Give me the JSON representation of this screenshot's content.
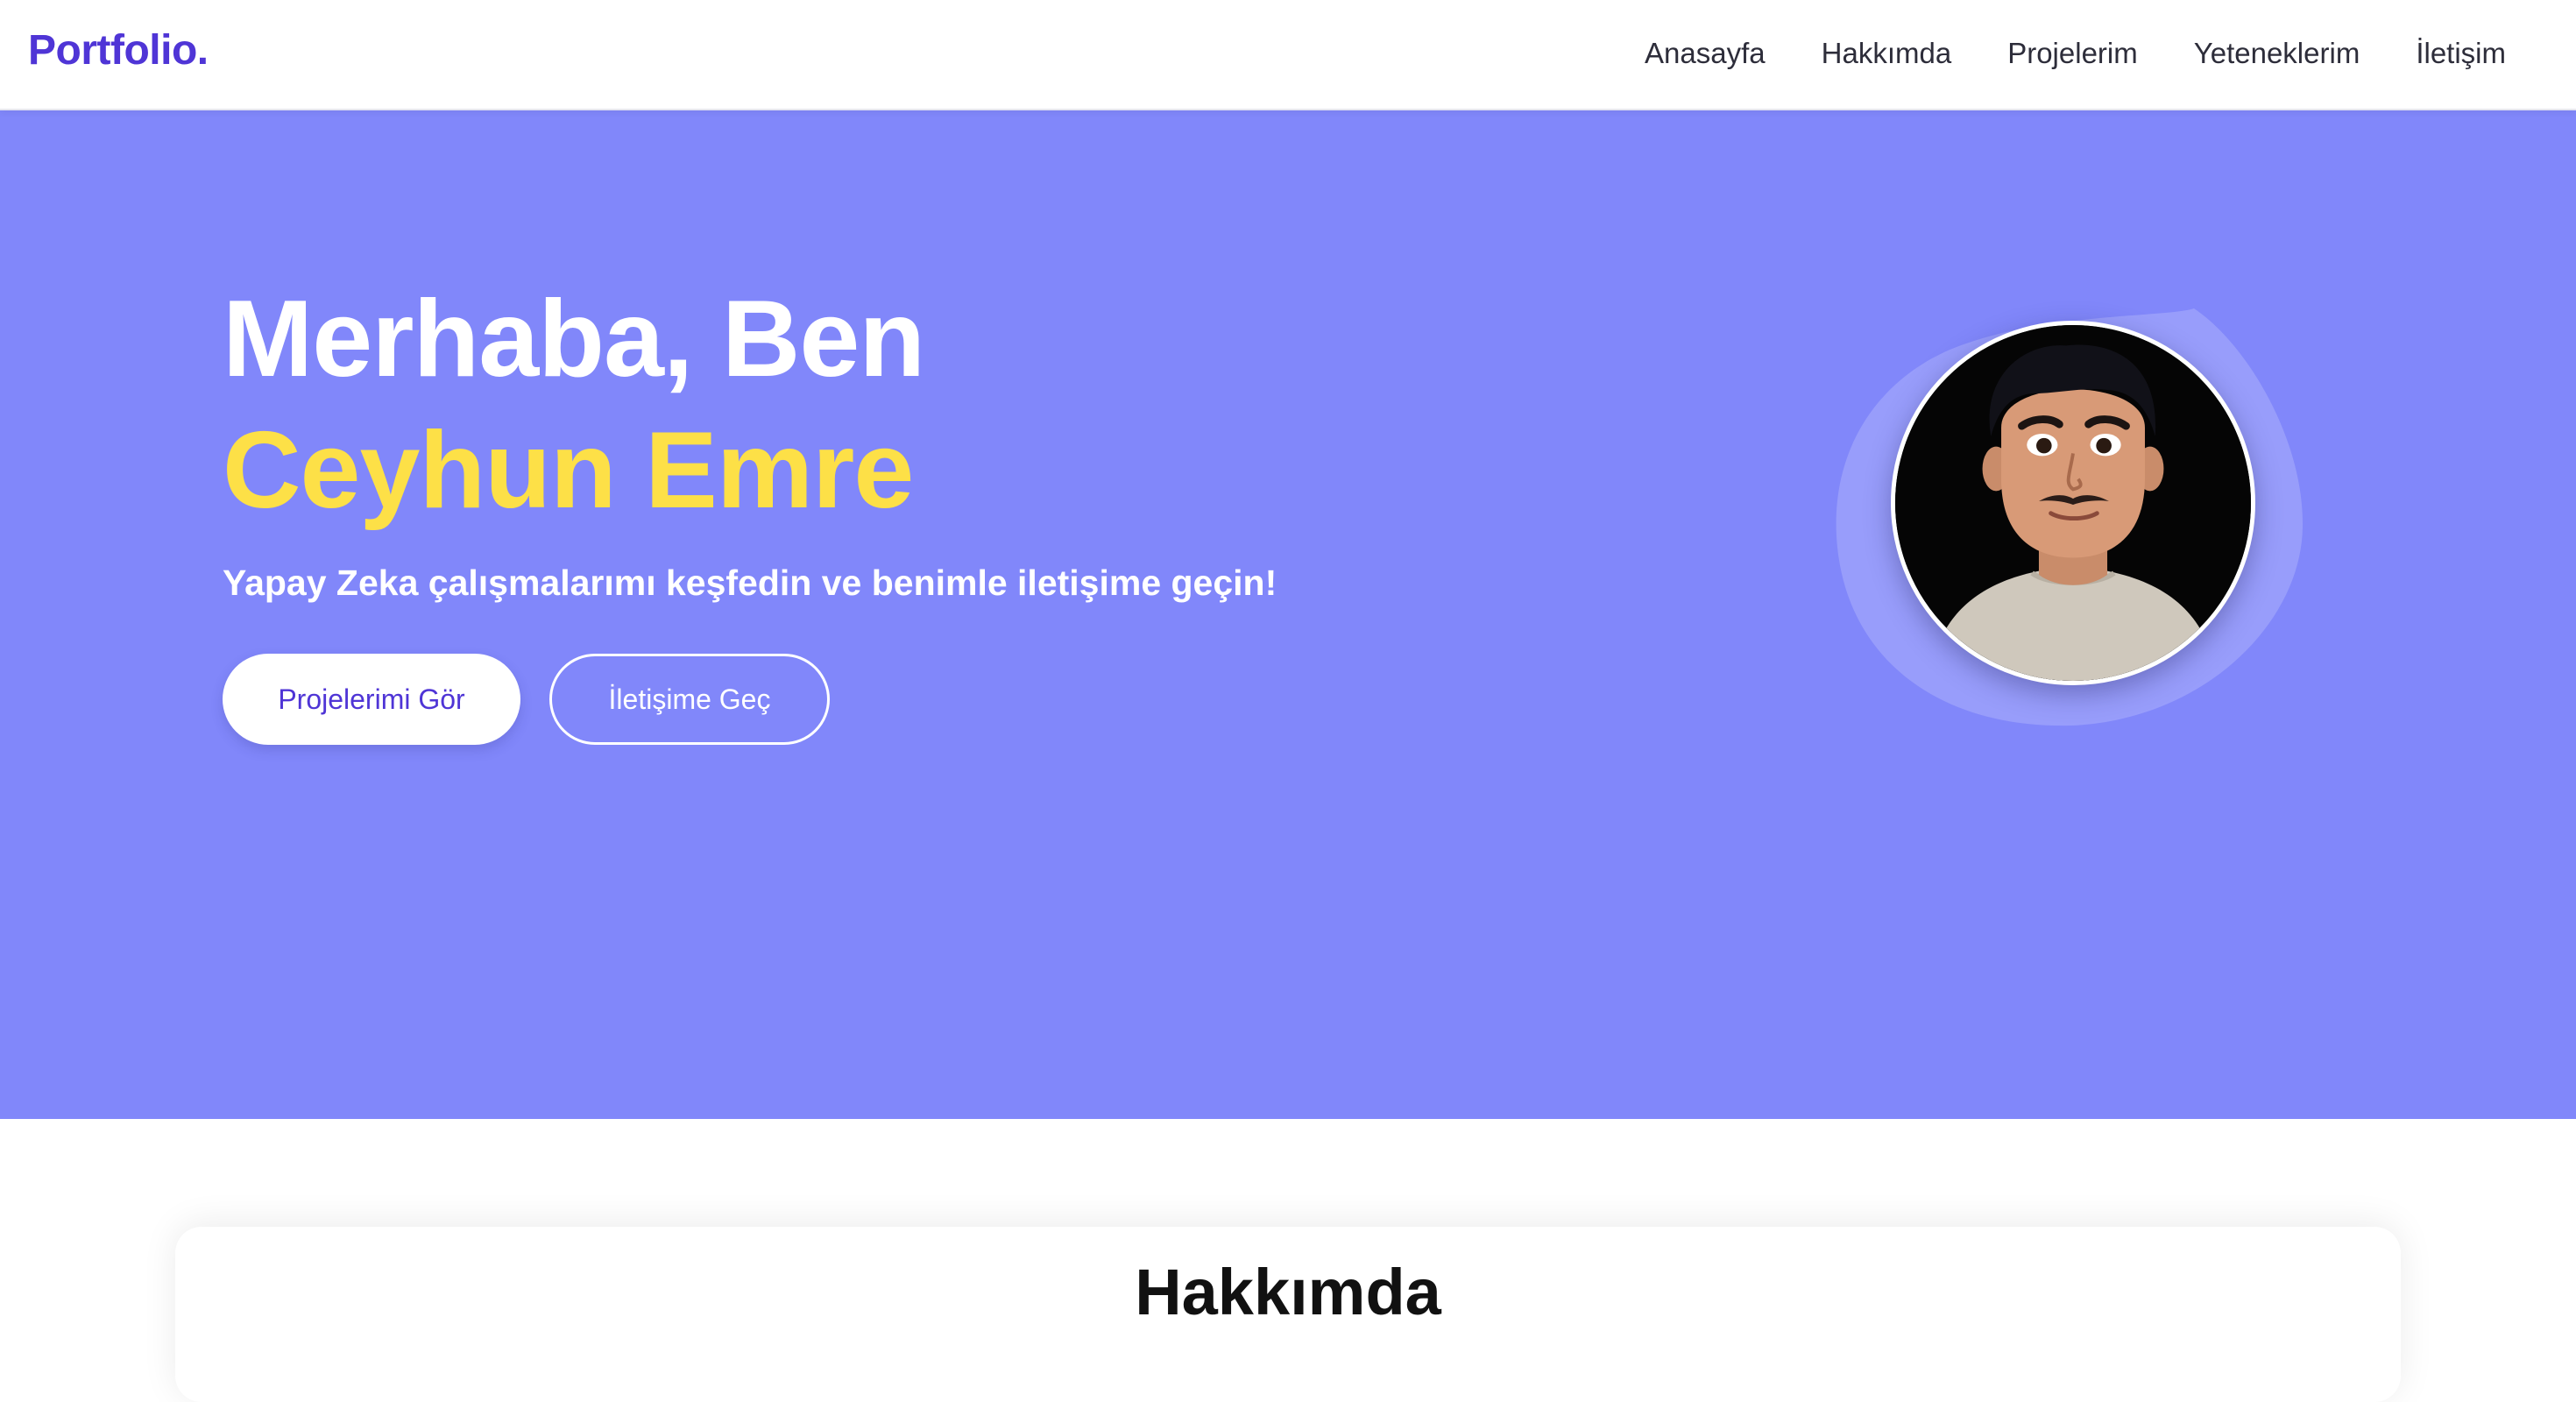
{
  "nav": {
    "logo": "Portfolio.",
    "links": [
      "Anasayfa",
      "Hakkımda",
      "Projelerim",
      "Yeteneklerim",
      "İletişim"
    ]
  },
  "hero": {
    "greeting": "Merhaba, Ben",
    "name": "Ceyhun Emre",
    "subtitle": "Yapay Zeka çalışmalarımı keşfedin ve benimle iletişime geçin!",
    "primary_button": "Projelerimi Gör",
    "secondary_button": "İletişime Geç"
  },
  "about": {
    "title": "Hakkımda"
  },
  "colors": {
    "brand": "#4f35d6",
    "hero_bg": "#8187fa",
    "name_highlight": "#fde047"
  },
  "icons": {
    "avatar": "profile-avatar-illustration"
  }
}
